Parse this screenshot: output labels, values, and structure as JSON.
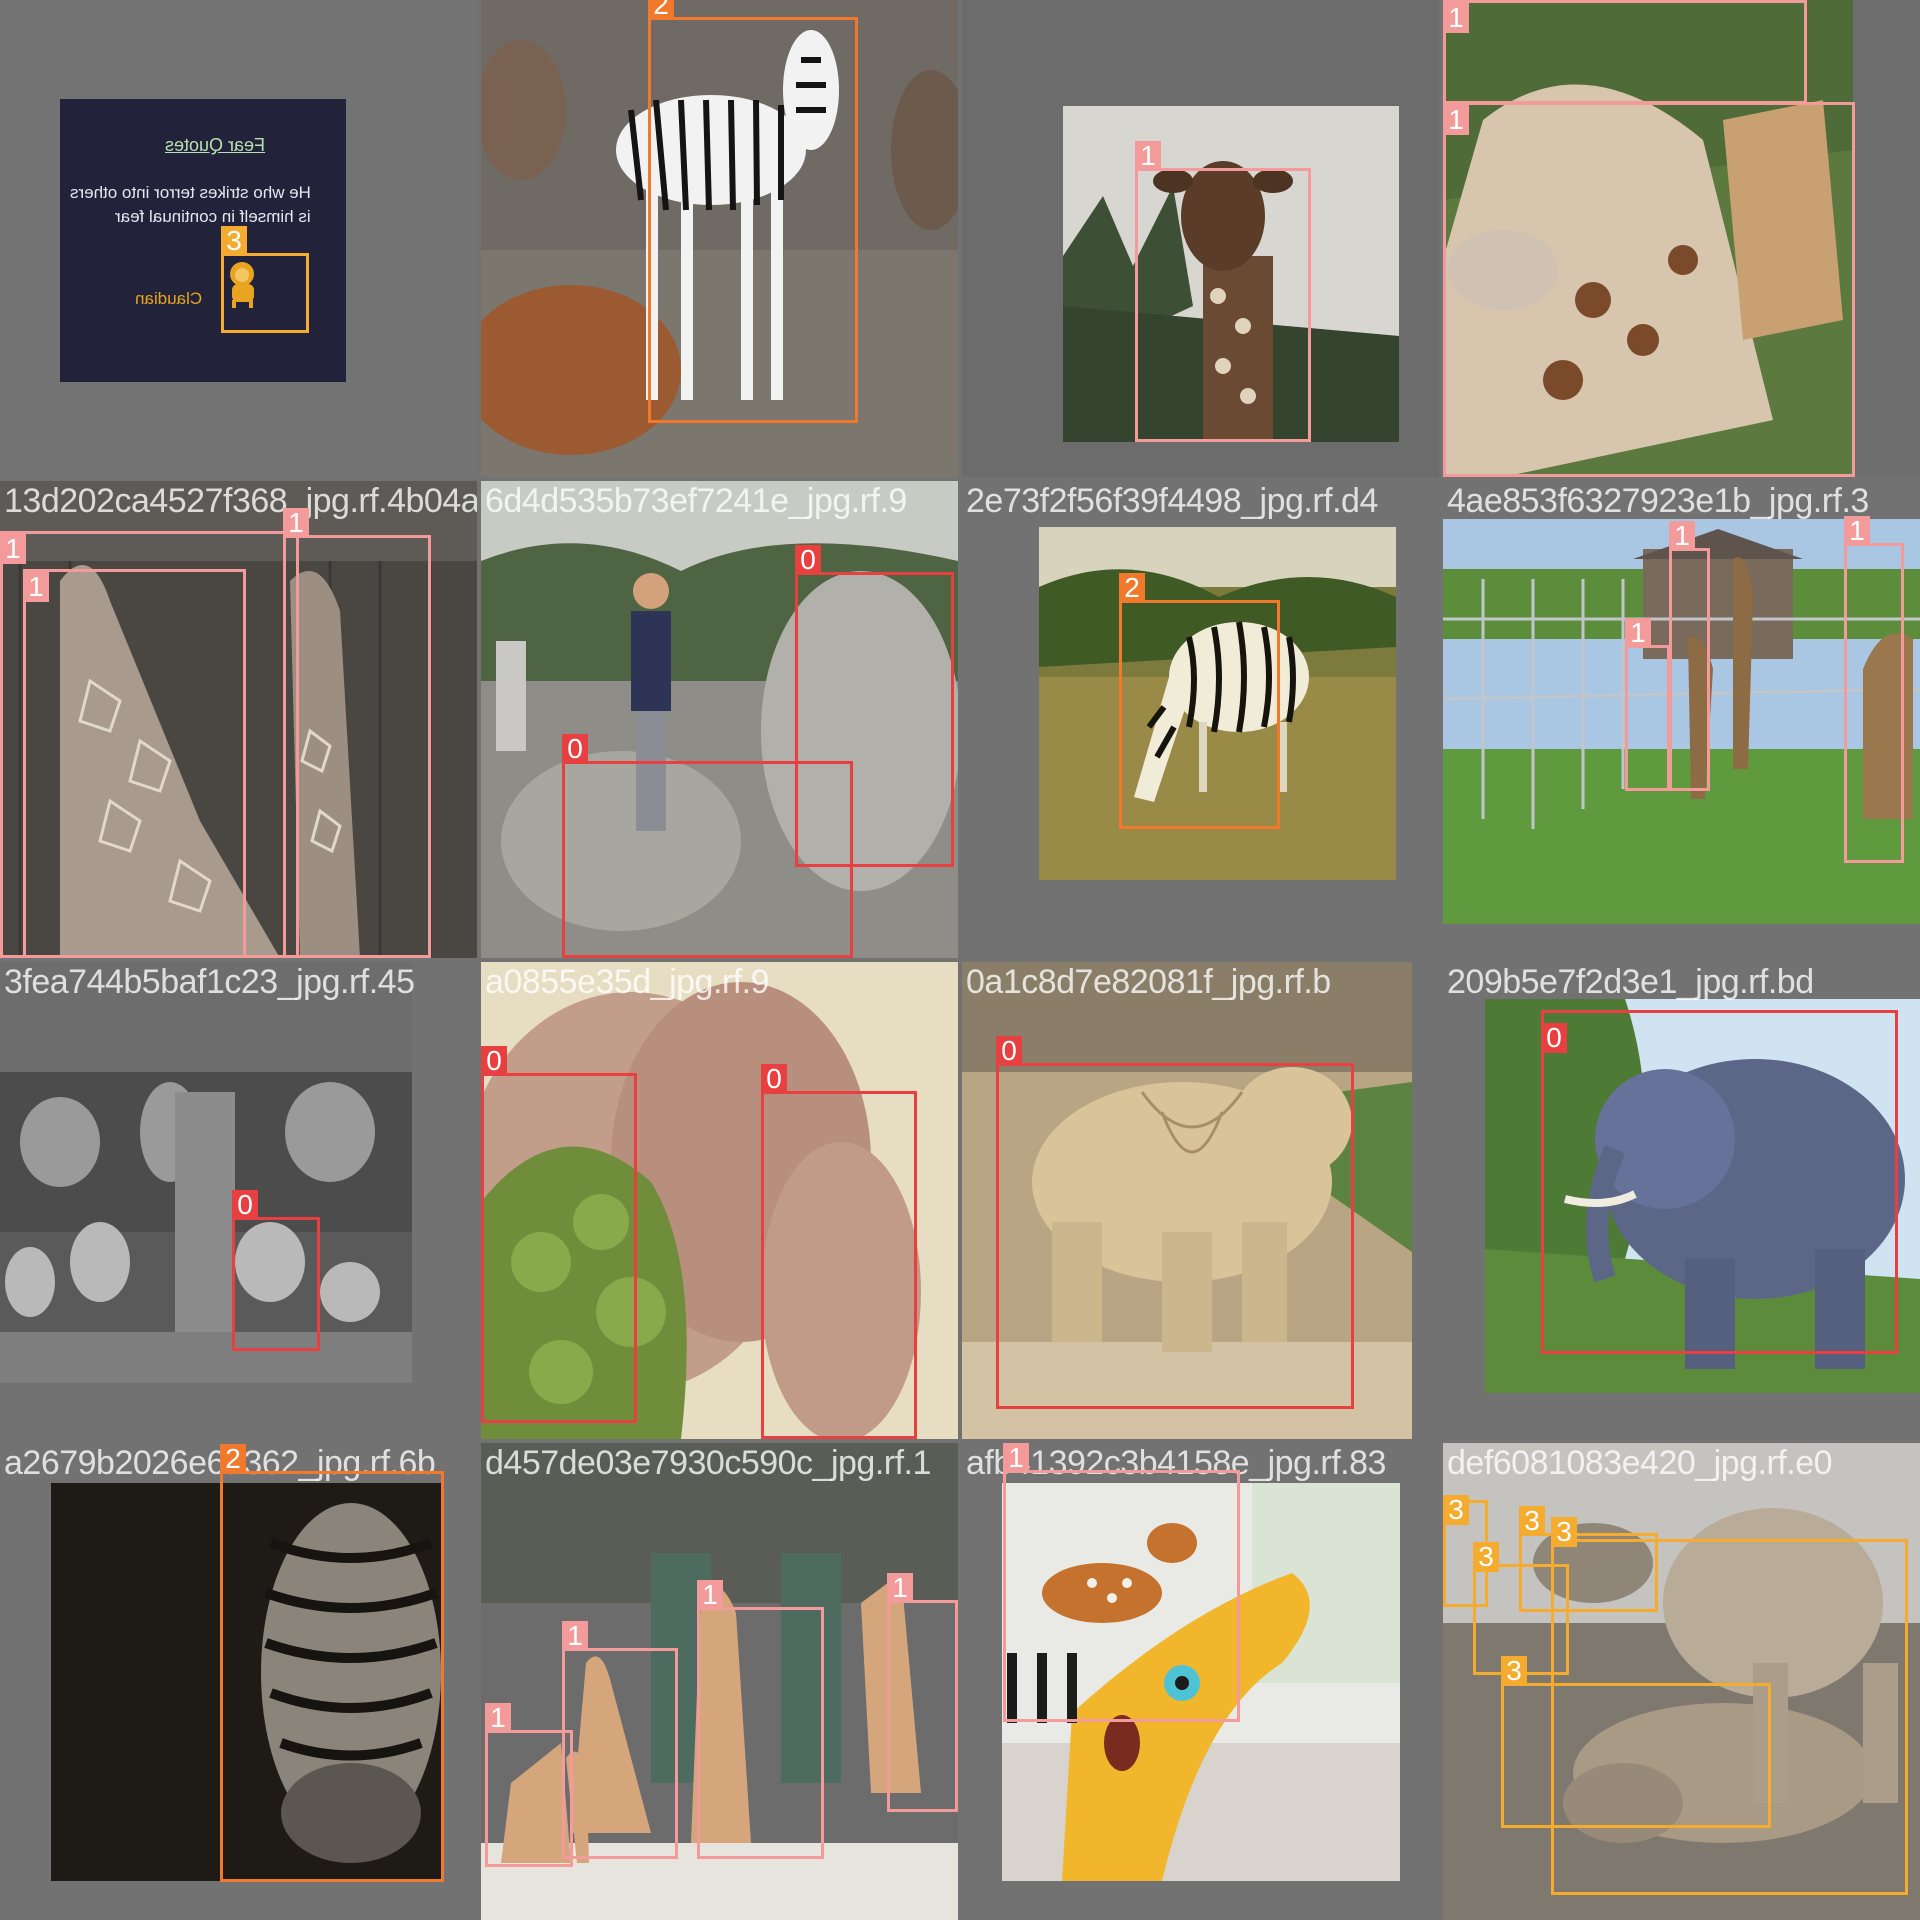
{
  "colors": {
    "background": "#727272",
    "class_0": "#e84040",
    "class_1": "#f39a9a",
    "class_2": "#f0792c",
    "class_3": "#f5ac2e",
    "label_text": "#ffffff"
  },
  "tiles": [
    {
      "filename": "",
      "quote_title": "Fear Quotes",
      "quote_line1": "He who strikes terror into others",
      "quote_line2": "is himself in continual fear",
      "quote_author": "Claudian",
      "labels": [
        "3"
      ]
    },
    {
      "filename": "",
      "labels": [
        "2"
      ]
    },
    {
      "filename": "",
      "labels": [
        "1"
      ]
    },
    {
      "filename": "",
      "labels": [
        "1",
        "1"
      ]
    },
    {
      "filename": "13d202ca4527f368_jpg.rf.4b04a65574e4f7241",
      "labels": [
        "1",
        "1",
        "1"
      ]
    },
    {
      "filename": "6d4d535b73ef7241e_jpg.rf.9",
      "labels": [
        "0",
        "0"
      ]
    },
    {
      "filename": "2e73f2f56f39f4498_jpg.rf.d4",
      "labels": [
        "2"
      ]
    },
    {
      "filename": "4ae853f6327923e1b_jpg.rf.3",
      "labels": [
        "1",
        "1",
        "1"
      ]
    },
    {
      "filename": "3fea744b5baf1c23_jpg.rf.45",
      "labels": [
        "0"
      ]
    },
    {
      "filename": "a0855e35d_jpg.rf.9",
      "labels": [
        "0",
        "0"
      ]
    },
    {
      "filename": "0a1c8d7e82081f_jpg.rf.b",
      "labels": [
        "0"
      ]
    },
    {
      "filename": "209b5e7f2d3e1_jpg.rf.bd",
      "labels": [
        "0"
      ]
    },
    {
      "filename": "a2679b2026e6a362_jpg.rf.6b",
      "labels": [
        "2"
      ]
    },
    {
      "filename": "d457de03e7930c590c_jpg.rf.1",
      "labels": [
        "1",
        "1",
        "1",
        "1"
      ]
    },
    {
      "filename": "afb41392c3b4158e_jpg.rf.83",
      "labels": [
        "1"
      ]
    },
    {
      "filename": "def6081083e420_jpg.rf.e0",
      "labels": [
        "3",
        "3",
        "3",
        "3",
        "3"
      ]
    }
  ]
}
